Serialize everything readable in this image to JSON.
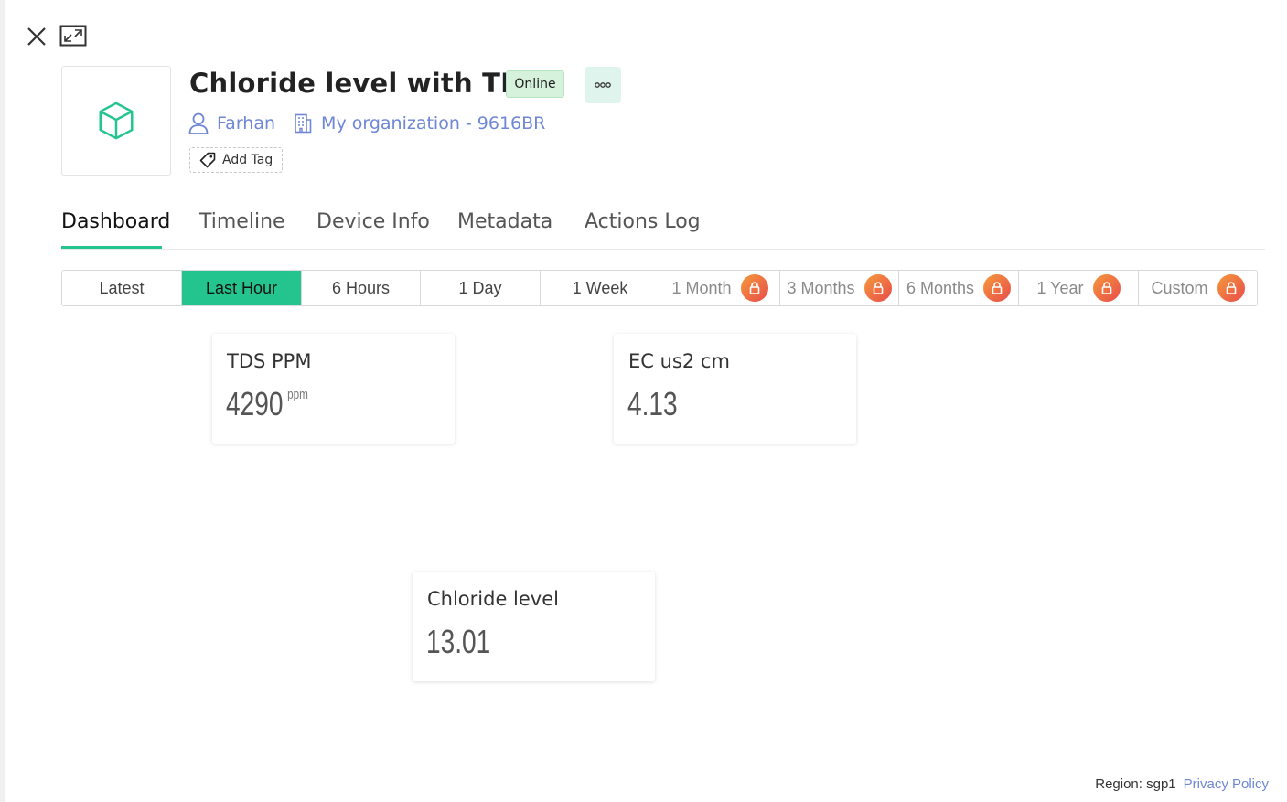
{
  "device": {
    "name": "Chloride level with TDS",
    "status": "Online",
    "owner": "Farhan",
    "organization": "My organization - 9616BR",
    "add_tag_label": "Add Tag"
  },
  "icons": {
    "close": "close-icon",
    "expand": "expand-icon",
    "device": "cube-icon",
    "more": "more-dots-icon",
    "owner": "user-icon",
    "organization": "building-icon",
    "tag": "tag-icon",
    "lock": "lock-icon"
  },
  "tabs": [
    {
      "label": "Dashboard",
      "active": true
    },
    {
      "label": "Timeline",
      "active": false
    },
    {
      "label": "Device Info",
      "active": false
    },
    {
      "label": "Metadata",
      "active": false
    },
    {
      "label": "Actions Log",
      "active": false
    }
  ],
  "time_ranges": [
    {
      "label": "Latest",
      "active": false,
      "locked": false
    },
    {
      "label": "Last Hour",
      "active": true,
      "locked": false
    },
    {
      "label": "6 Hours",
      "active": false,
      "locked": false
    },
    {
      "label": "1 Day",
      "active": false,
      "locked": false
    },
    {
      "label": "1 Week",
      "active": false,
      "locked": false
    },
    {
      "label": "1 Month",
      "active": false,
      "locked": true
    },
    {
      "label": "3 Months",
      "active": false,
      "locked": true
    },
    {
      "label": "6 Months",
      "active": false,
      "locked": true
    },
    {
      "label": "1 Year",
      "active": false,
      "locked": true
    },
    {
      "label": "Custom",
      "active": false,
      "locked": true
    }
  ],
  "widgets": {
    "tds": {
      "title": "TDS PPM",
      "value": "4290",
      "unit": "ppm"
    },
    "ec": {
      "title": "EC us2 cm",
      "value": "4.13"
    },
    "chloride": {
      "title": "Chloride level",
      "value": "13.01"
    }
  },
  "footer": {
    "region": "Region: sgp1",
    "privacy": "Privacy Policy"
  },
  "colors": {
    "accent": "#23c48e",
    "link": "#6e86d6",
    "online_badge": "#d6f2dc",
    "lock_badge_start": "#f59a3a",
    "lock_badge_end": "#e84b4b"
  }
}
